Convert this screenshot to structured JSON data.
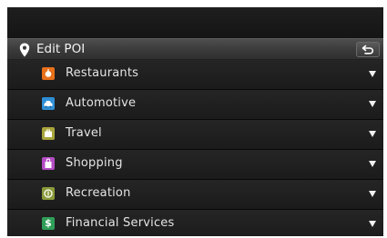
{
  "header": {
    "title": "Edit POI",
    "pin_icon": "location-pin-icon",
    "back_icon": "back-arrow-icon"
  },
  "categories": [
    {
      "label": "Restaurants",
      "icon": "restaurant-icon",
      "color": "#e8701a"
    },
    {
      "label": "Automotive",
      "icon": "car-icon",
      "color": "#2f8fd6"
    },
    {
      "label": "Travel",
      "icon": "luggage-icon",
      "color": "#a8a53c"
    },
    {
      "label": "Shopping",
      "icon": "shopping-bag-icon",
      "color": "#b54cc4"
    },
    {
      "label": "Recreation",
      "icon": "recreation-icon",
      "color": "#8a9a3a"
    },
    {
      "label": "Financial Services",
      "icon": "dollar-icon",
      "color": "#2f9e58"
    }
  ]
}
